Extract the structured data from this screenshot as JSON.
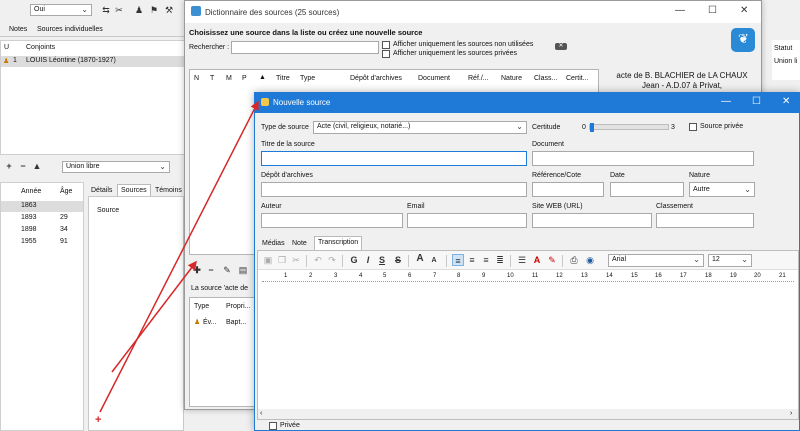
{
  "main": {
    "top_select": "Oui",
    "tabs": [
      "Notes",
      "Sources individuelles"
    ],
    "spouse_cols": [
      "U",
      "Conjoints"
    ],
    "spouse_row": {
      "u": "1",
      "name": "LOUIS Léontine (1870-1927)"
    },
    "union_select": "Union libre",
    "event_cols": [
      "Année",
      "Âge"
    ],
    "event_rows": [
      {
        "year": "1863",
        "age": ""
      },
      {
        "year": "1893",
        "age": "29"
      },
      {
        "year": "1898",
        "age": "34"
      },
      {
        "year": "1955",
        "age": "91"
      }
    ],
    "detail_tabs": [
      "Détails",
      "Sources",
      "Témoins"
    ],
    "source_col": "Source",
    "right_cols": [
      "Statut",
      "Union li"
    ],
    "red_plus": "+"
  },
  "dict": {
    "title": "Dictionnaire des sources (25 sources)",
    "heading": "Choisissez une source dans la liste ou créez une nouvelle source",
    "search_label": "Rechercher :",
    "search_value": "",
    "cb_unused": "Afficher uniquement les sources non utilisées",
    "cb_private": "Afficher uniquement les sources privées",
    "columns": [
      "N",
      "T",
      "M",
      "P",
      "",
      "Titre",
      "Type",
      "Dépôt d'archives",
      "Document",
      "Réf./...",
      "Nature",
      "Class...",
      "Certit..."
    ],
    "preview_text": "acte de B. BLACHIER de LA CHAUX Jean - A.D.07 à Privat,",
    "bottom_label": "La source 'acte de",
    "bottom_cols": [
      "Type",
      "Propri..."
    ],
    "bottom_row": {
      "type": "Év...",
      "prop": "Bapt..."
    }
  },
  "newsrc": {
    "title": "Nouvelle source",
    "type_label": "Type de source",
    "type_value": "Acte (civil, religieux, notarié...)",
    "certitude_label": "Certitude",
    "certitude_min": "0",
    "certitude_max": "3",
    "certitude_value": 0,
    "private_label": "Source privée",
    "title_label": "Titre de la source",
    "document_label": "Document",
    "depot_label": "Dépôt d'archives",
    "ref_label": "Référence/Cote",
    "date_label": "Date",
    "nature_label": "Nature",
    "nature_value": "Autre",
    "author_label": "Auteur",
    "email_label": "Email",
    "web_label": "Site WEB (URL)",
    "class_label": "Classement",
    "tabs": [
      "Médias",
      "Note",
      "Transcription"
    ],
    "font_value": "Arial",
    "size_value": "12",
    "ruler_numbers": [
      "1",
      "2",
      "3",
      "4",
      "5",
      "6",
      "7",
      "8",
      "9",
      "10",
      "11",
      "12",
      "13",
      "14",
      "15",
      "16",
      "17",
      "18",
      "19",
      "20",
      "21"
    ],
    "prive_label": "Privée"
  },
  "colors": {
    "accent": "#1e7ad6",
    "arrow": "#d62828"
  }
}
